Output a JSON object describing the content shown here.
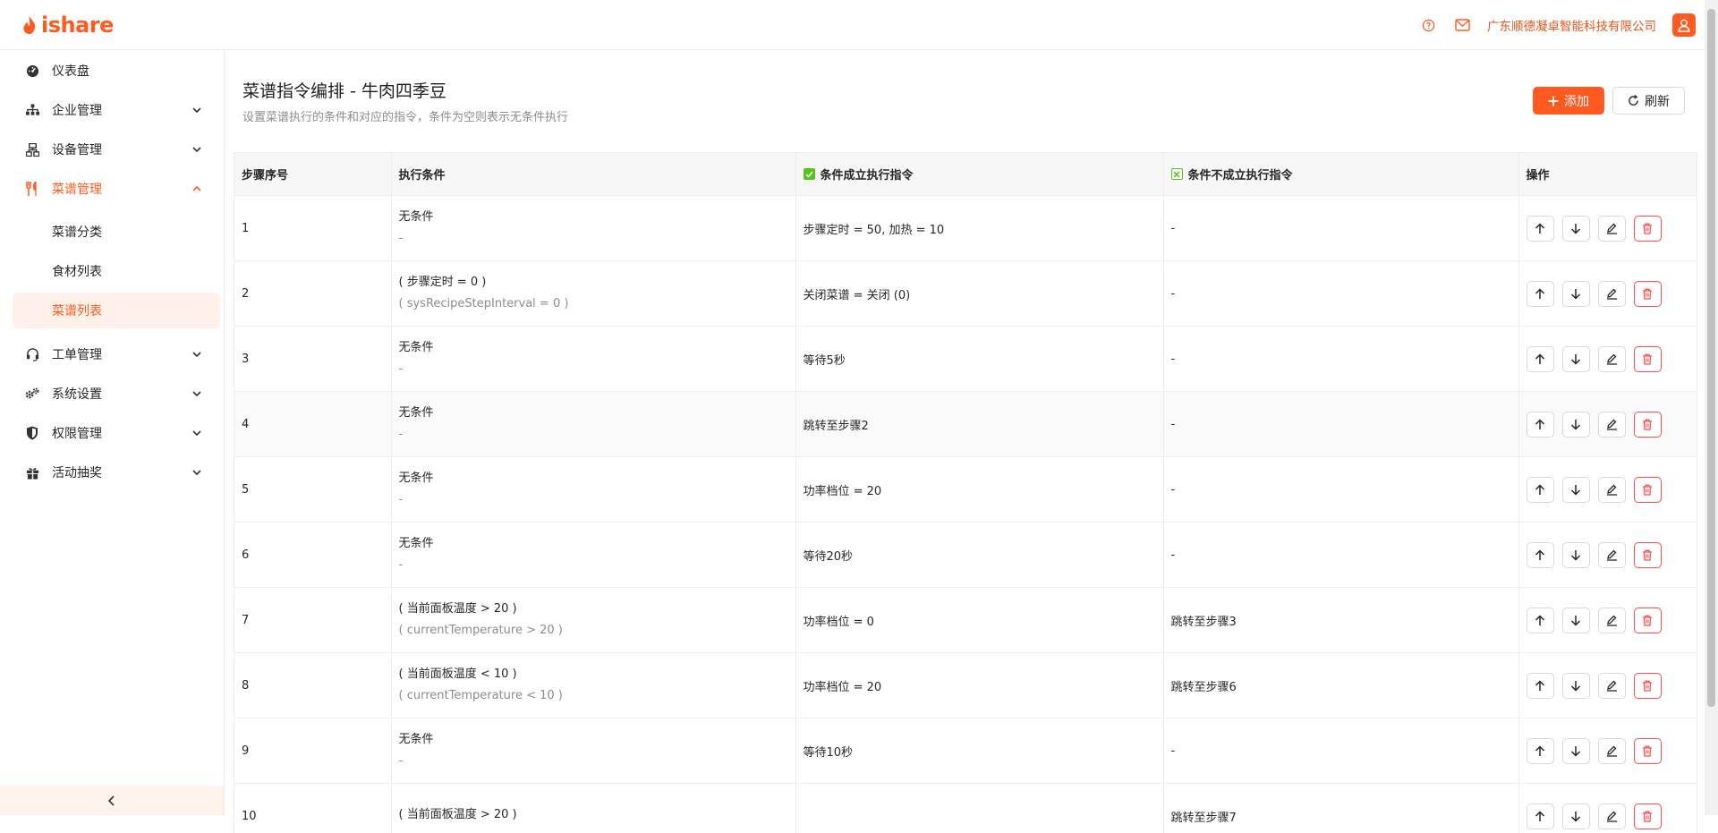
{
  "header": {
    "logo_text": "ishare",
    "company": "广东顺德凝卓智能科技有限公司"
  },
  "sidebar": {
    "items": [
      {
        "label": "仪表盘",
        "icon": "dashboard-icon"
      },
      {
        "label": "企业管理",
        "icon": "org-icon"
      },
      {
        "label": "设备管理",
        "icon": "device-icon"
      },
      {
        "label": "菜谱管理",
        "icon": "fork-knife-icon"
      },
      {
        "label": "工单管理",
        "icon": "headset-icon"
      },
      {
        "label": "系统设置",
        "icon": "gears-icon"
      },
      {
        "label": "权限管理",
        "icon": "shield-icon"
      },
      {
        "label": "活动抽奖",
        "icon": "gift-icon"
      }
    ],
    "sub_items": [
      {
        "label": "菜谱分类"
      },
      {
        "label": "食材列表"
      },
      {
        "label": "菜谱列表"
      }
    ]
  },
  "page": {
    "title": "菜谱指令编排 - 牛肉四季豆",
    "subtitle": "设置菜谱执行的条件和对应的指令，条件为空则表示无条件执行",
    "add_label": "添加",
    "refresh_label": "刷新"
  },
  "table": {
    "headers": {
      "step": "步骤序号",
      "condition": "执行条件",
      "true_cmd": "条件成立执行指令",
      "false_cmd": "条件不成立执行指令",
      "ops": "操作"
    },
    "rows": [
      {
        "step": "1",
        "cond": "无条件",
        "cond_expr": "-",
        "true_cmd": "步骤定时 = 50, 加热 = 10",
        "false_cmd": "-"
      },
      {
        "step": "2",
        "cond": "( 步骤定时 = 0 )",
        "cond_expr": "( sysRecipeStepInterval = 0 )",
        "true_cmd": "关闭菜谱 = 关闭 (0)",
        "false_cmd": "-"
      },
      {
        "step": "3",
        "cond": "无条件",
        "cond_expr": "-",
        "true_cmd": "等待5秒",
        "false_cmd": "-"
      },
      {
        "step": "4",
        "cond": "无条件",
        "cond_expr": "-",
        "true_cmd": "跳转至步骤2",
        "false_cmd": "-"
      },
      {
        "step": "5",
        "cond": "无条件",
        "cond_expr": "-",
        "true_cmd": "功率档位 = 20",
        "false_cmd": "-"
      },
      {
        "step": "6",
        "cond": "无条件",
        "cond_expr": "-",
        "true_cmd": "等待20秒",
        "false_cmd": "-"
      },
      {
        "step": "7",
        "cond": "( 当前面板温度 > 20 )",
        "cond_expr": "( currentTemperature > 20 )",
        "true_cmd": "功率档位 = 0",
        "false_cmd": "跳转至步骤3"
      },
      {
        "step": "8",
        "cond": "( 当前面板温度 < 10 )",
        "cond_expr": "( currentTemperature < 10 )",
        "true_cmd": "功率档位 = 20",
        "false_cmd": "跳转至步骤6"
      },
      {
        "step": "9",
        "cond": "无条件",
        "cond_expr": "-",
        "true_cmd": "等待10秒",
        "false_cmd": "-"
      },
      {
        "step": "10",
        "cond": "( 当前面板温度 > 20 )",
        "cond_expr": "",
        "true_cmd": "",
        "false_cmd": "跳转至步骤7"
      }
    ]
  },
  "colors": {
    "accent": "#ff5a1f",
    "danger": "#ff4d4f",
    "success": "#52c41a"
  }
}
